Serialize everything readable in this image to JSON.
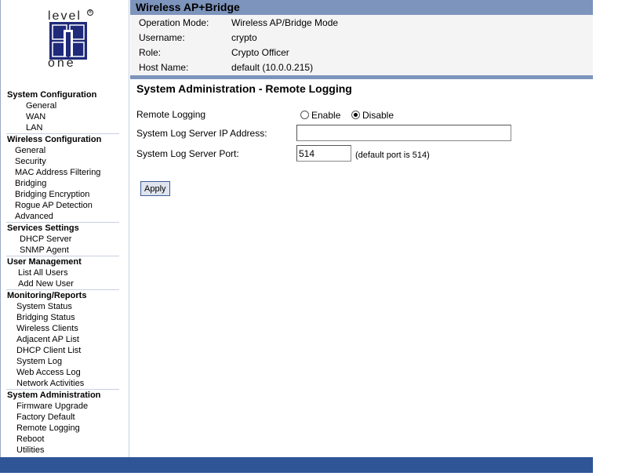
{
  "logo": {
    "line1": "level",
    "line2": "one",
    "reg": "®"
  },
  "header": {
    "title": "Wireless AP+Bridge",
    "info": [
      {
        "label": "Operation Mode:",
        "value": "Wireless AP/Bridge Mode"
      },
      {
        "label": "Username:",
        "value": "crypto"
      },
      {
        "label": "Role:",
        "value": "Crypto Officer"
      },
      {
        "label": "Host Name:",
        "value": "default (10.0.0.215)"
      }
    ]
  },
  "sidebar": {
    "sections": [
      {
        "title": "System Configuration",
        "items": [
          "General",
          "WAN",
          "LAN"
        ]
      },
      {
        "title": "Wireless Configuration",
        "items": [
          "General",
          "Security",
          "MAC Address Filtering",
          "Bridging",
          "Bridging Encryption",
          "Rogue AP Detection",
          "Advanced"
        ]
      },
      {
        "title": "Services Settings",
        "items": [
          "DHCP Server",
          "SNMP Agent"
        ]
      },
      {
        "title": "User Management",
        "items": [
          "List All Users",
          "Add New User"
        ]
      },
      {
        "title": "Monitoring/Reports",
        "items": [
          "System Status",
          "Bridging Status",
          "Wireless Clients",
          "Adjacent AP List",
          "DHCP Client List",
          "System Log",
          "Web Access Log",
          "Network Activities"
        ]
      },
      {
        "title": "System Administration",
        "items": [
          "Firmware Upgrade",
          "Factory Default",
          "Remote Logging",
          "Reboot",
          "Utilities"
        ]
      }
    ]
  },
  "main": {
    "title": "System Administration - Remote Logging",
    "remote_logging": {
      "label": "Remote Logging",
      "enable": "Enable",
      "disable": "Disable",
      "selected": "Disable"
    },
    "server_ip": {
      "label": "System Log Server IP Address:",
      "value": ""
    },
    "server_port": {
      "label": "System Log Server Port:",
      "value": "514",
      "hint": "(default port is 514)"
    },
    "apply_label": "Apply"
  },
  "colors": {
    "header": "#7d94bc",
    "footer": "#2f5597",
    "logo": "#1f2a7a"
  }
}
